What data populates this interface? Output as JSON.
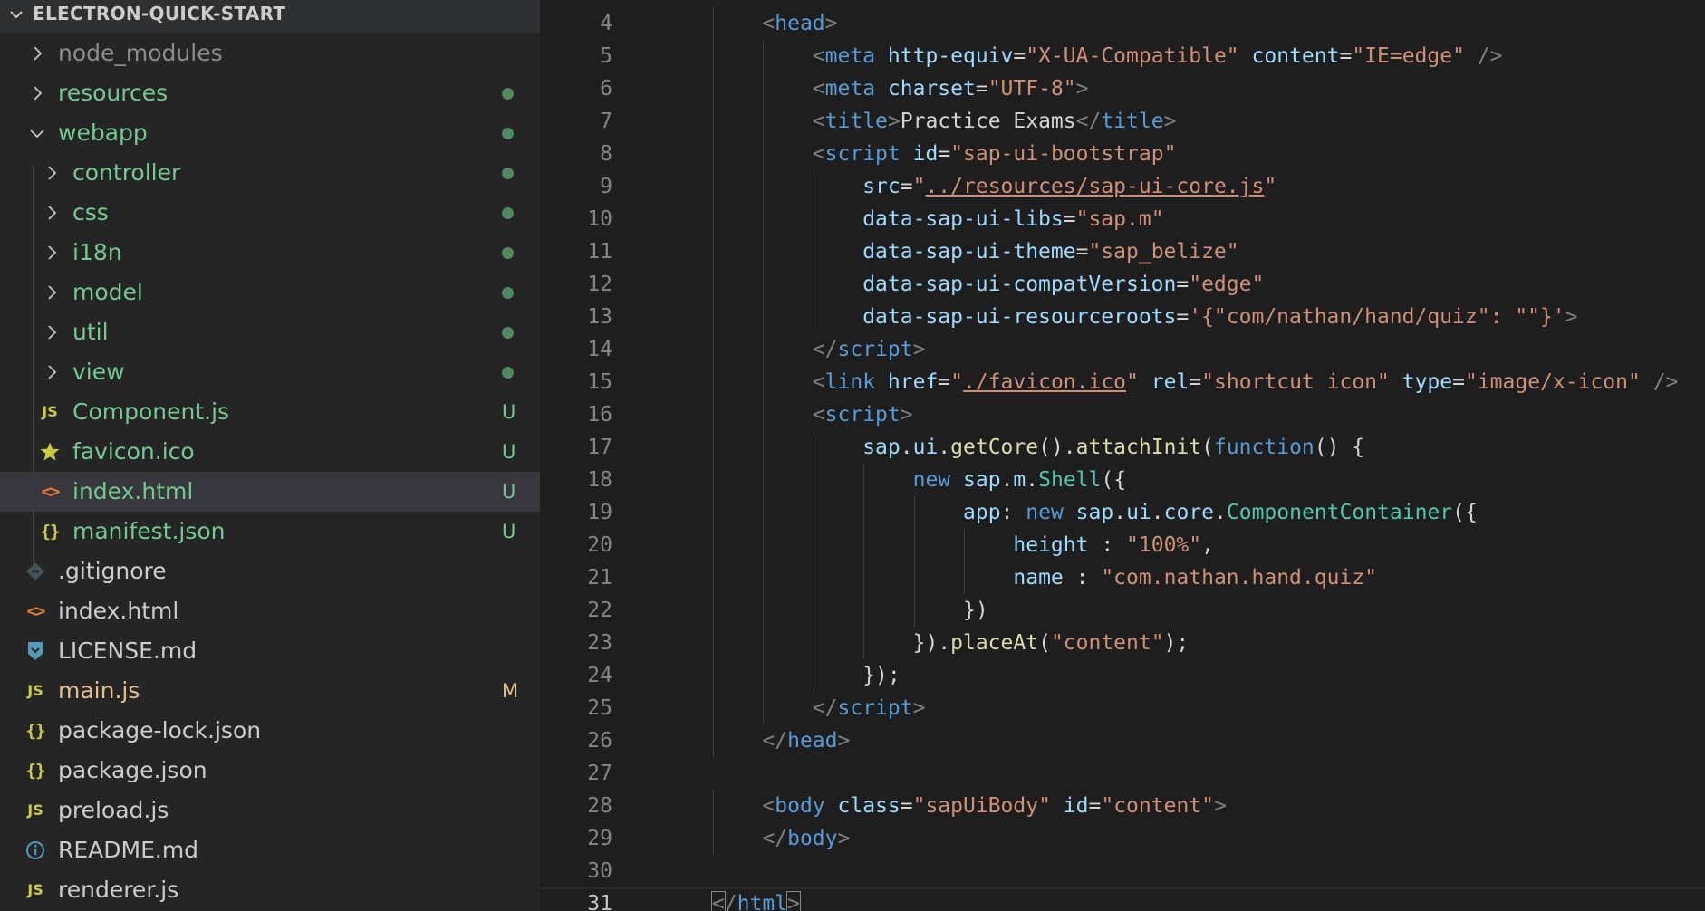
{
  "explorer": {
    "title": "ELECTRON-QUICK-START",
    "items": [
      {
        "label": "node_modules",
        "kind": "folder",
        "expanded": false,
        "level": 0,
        "color": "#8c8c8c",
        "decoration": ""
      },
      {
        "label": "resources",
        "kind": "folder",
        "expanded": false,
        "level": 0,
        "color": "#73c991",
        "decoration": "dot"
      },
      {
        "label": "webapp",
        "kind": "folder",
        "expanded": true,
        "level": 0,
        "color": "#73c991",
        "decoration": "dot"
      },
      {
        "label": "controller",
        "kind": "folder",
        "expanded": false,
        "level": 1,
        "color": "#73c991",
        "decoration": "dot"
      },
      {
        "label": "css",
        "kind": "folder",
        "expanded": false,
        "level": 1,
        "color": "#73c991",
        "decoration": "dot"
      },
      {
        "label": "i18n",
        "kind": "folder",
        "expanded": false,
        "level": 1,
        "color": "#73c991",
        "decoration": "dot"
      },
      {
        "label": "model",
        "kind": "folder",
        "expanded": false,
        "level": 1,
        "color": "#73c991",
        "decoration": "dot"
      },
      {
        "label": "util",
        "kind": "folder",
        "expanded": false,
        "level": 1,
        "color": "#73c991",
        "decoration": "dot"
      },
      {
        "label": "view",
        "kind": "folder",
        "expanded": false,
        "level": 1,
        "color": "#73c991",
        "decoration": "dot"
      },
      {
        "label": "Component.js",
        "kind": "js",
        "level": 1,
        "color": "#73c991",
        "decoration": "U"
      },
      {
        "label": "favicon.ico",
        "kind": "star",
        "level": 1,
        "color": "#73c991",
        "decoration": "U"
      },
      {
        "label": "index.html",
        "kind": "html",
        "level": 1,
        "color": "#73c991",
        "decoration": "U",
        "selected": true
      },
      {
        "label": "manifest.json",
        "kind": "json",
        "level": 1,
        "color": "#73c991",
        "decoration": "U"
      },
      {
        "label": ".gitignore",
        "kind": "git",
        "level": 0,
        "color": "#cccccc",
        "decoration": ""
      },
      {
        "label": "index.html",
        "kind": "html",
        "level": 0,
        "color": "#cccccc",
        "decoration": ""
      },
      {
        "label": "LICENSE.md",
        "kind": "license",
        "level": 0,
        "color": "#cccccc",
        "decoration": ""
      },
      {
        "label": "main.js",
        "kind": "js",
        "level": 0,
        "color": "#e2c08d",
        "decoration": "M"
      },
      {
        "label": "package-lock.json",
        "kind": "json",
        "level": 0,
        "color": "#cccccc",
        "decoration": ""
      },
      {
        "label": "package.json",
        "kind": "json",
        "level": 0,
        "color": "#cccccc",
        "decoration": ""
      },
      {
        "label": "preload.js",
        "kind": "js",
        "level": 0,
        "color": "#cccccc",
        "decoration": ""
      },
      {
        "label": "README.md",
        "kind": "info",
        "level": 0,
        "color": "#cccccc",
        "decoration": ""
      },
      {
        "label": "renderer.js",
        "kind": "js",
        "level": 0,
        "color": "#cccccc",
        "decoration": ""
      }
    ],
    "decoration_colors": {
      "dot": "#4f8a5f",
      "U": "#73c991",
      "M": "#e2c08d"
    }
  },
  "editor": {
    "active_line": 31,
    "lines": [
      {
        "n": 4,
        "indent": 1,
        "tokens": [
          [
            "tag",
            "<"
          ],
          [
            "tn",
            "head"
          ],
          [
            "tag",
            ">"
          ]
        ]
      },
      {
        "n": 5,
        "indent": 2,
        "tokens": [
          [
            "tag",
            "<"
          ],
          [
            "tn",
            "meta"
          ],
          [
            "txt",
            " "
          ],
          [
            "attr",
            "http-equiv"
          ],
          [
            "txt",
            "="
          ],
          [
            "str",
            "\"X-UA-Compatible\""
          ],
          [
            "txt",
            " "
          ],
          [
            "attr",
            "content"
          ],
          [
            "txt",
            "="
          ],
          [
            "str",
            "\"IE=edge\""
          ],
          [
            "txt",
            " "
          ],
          [
            "tag",
            "/>"
          ]
        ]
      },
      {
        "n": 6,
        "indent": 2,
        "tokens": [
          [
            "tag",
            "<"
          ],
          [
            "tn",
            "meta"
          ],
          [
            "txt",
            " "
          ],
          [
            "attr",
            "charset"
          ],
          [
            "txt",
            "="
          ],
          [
            "str",
            "\"UTF-8\""
          ],
          [
            "tag",
            ">"
          ]
        ]
      },
      {
        "n": 7,
        "indent": 2,
        "tokens": [
          [
            "tag",
            "<"
          ],
          [
            "tn",
            "title"
          ],
          [
            "tag",
            ">"
          ],
          [
            "txt",
            "Practice Exams"
          ],
          [
            "tag",
            "</"
          ],
          [
            "tn",
            "title"
          ],
          [
            "tag",
            ">"
          ]
        ]
      },
      {
        "n": 8,
        "indent": 2,
        "tokens": [
          [
            "tag",
            "<"
          ],
          [
            "tn",
            "script"
          ],
          [
            "txt",
            " "
          ],
          [
            "attr",
            "id"
          ],
          [
            "txt",
            "="
          ],
          [
            "str",
            "\"sap-ui-bootstrap\""
          ]
        ]
      },
      {
        "n": 9,
        "indent": 3,
        "tokens": [
          [
            "attr",
            "src"
          ],
          [
            "txt",
            "="
          ],
          [
            "str",
            "\""
          ],
          [
            "link",
            "../resources/sap-ui-core.js"
          ],
          [
            "str",
            "\""
          ]
        ]
      },
      {
        "n": 10,
        "indent": 3,
        "tokens": [
          [
            "attr",
            "data-sap-ui-libs"
          ],
          [
            "txt",
            "="
          ],
          [
            "str",
            "\"sap.m\""
          ]
        ]
      },
      {
        "n": 11,
        "indent": 3,
        "tokens": [
          [
            "attr",
            "data-sap-ui-theme"
          ],
          [
            "txt",
            "="
          ],
          [
            "str",
            "\"sap_belize\""
          ]
        ]
      },
      {
        "n": 12,
        "indent": 3,
        "tokens": [
          [
            "attr",
            "data-sap-ui-compatVersion"
          ],
          [
            "txt",
            "="
          ],
          [
            "str",
            "\"edge\""
          ]
        ]
      },
      {
        "n": 13,
        "indent": 3,
        "tokens": [
          [
            "attr",
            "data-sap-ui-resourceroots"
          ],
          [
            "txt",
            "="
          ],
          [
            "str",
            "'{\"com/nathan/hand/quiz\": \"\"}'"
          ],
          [
            "tag",
            ">"
          ]
        ]
      },
      {
        "n": 14,
        "indent": 2,
        "tokens": [
          [
            "tag",
            "</"
          ],
          [
            "tn",
            "script"
          ],
          [
            "tag",
            ">"
          ]
        ]
      },
      {
        "n": 15,
        "indent": 2,
        "tokens": [
          [
            "tag",
            "<"
          ],
          [
            "tn",
            "link"
          ],
          [
            "txt",
            " "
          ],
          [
            "attr",
            "href"
          ],
          [
            "txt",
            "="
          ],
          [
            "str",
            "\""
          ],
          [
            "link",
            "./favicon.ico"
          ],
          [
            "str",
            "\""
          ],
          [
            "txt",
            " "
          ],
          [
            "attr",
            "rel"
          ],
          [
            "txt",
            "="
          ],
          [
            "str",
            "\"shortcut icon\""
          ],
          [
            "txt",
            " "
          ],
          [
            "attr",
            "type"
          ],
          [
            "txt",
            "="
          ],
          [
            "str",
            "\"image/x-icon\""
          ],
          [
            "txt",
            " "
          ],
          [
            "tag",
            "/>"
          ]
        ]
      },
      {
        "n": 16,
        "indent": 2,
        "tokens": [
          [
            "tag",
            "<"
          ],
          [
            "tn",
            "script"
          ],
          [
            "tag",
            ">"
          ]
        ]
      },
      {
        "n": 17,
        "indent": 3,
        "tokens": [
          [
            "var",
            "sap"
          ],
          [
            "txt",
            "."
          ],
          [
            "var",
            "ui"
          ],
          [
            "txt",
            "."
          ],
          [
            "fn",
            "getCore"
          ],
          [
            "txt",
            "()."
          ],
          [
            "fn",
            "attachInit"
          ],
          [
            "txt",
            "("
          ],
          [
            "kw",
            "function"
          ],
          [
            "txt",
            "() {"
          ]
        ]
      },
      {
        "n": 18,
        "indent": 4,
        "tokens": [
          [
            "kw",
            "new"
          ],
          [
            "txt",
            " "
          ],
          [
            "var",
            "sap"
          ],
          [
            "txt",
            "."
          ],
          [
            "var",
            "m"
          ],
          [
            "txt",
            "."
          ],
          [
            "cls",
            "Shell"
          ],
          [
            "txt",
            "({"
          ]
        ]
      },
      {
        "n": 19,
        "indent": 5,
        "tokens": [
          [
            "var",
            "app"
          ],
          [
            "txt",
            ": "
          ],
          [
            "kw",
            "new"
          ],
          [
            "txt",
            " "
          ],
          [
            "var",
            "sap"
          ],
          [
            "txt",
            "."
          ],
          [
            "var",
            "ui"
          ],
          [
            "txt",
            "."
          ],
          [
            "var",
            "core"
          ],
          [
            "txt",
            "."
          ],
          [
            "cls",
            "ComponentContainer"
          ],
          [
            "txt",
            "({"
          ]
        ]
      },
      {
        "n": 20,
        "indent": 6,
        "tokens": [
          [
            "var",
            "height"
          ],
          [
            "txt",
            " : "
          ],
          [
            "str",
            "\"100%\""
          ],
          [
            "txt",
            ","
          ]
        ]
      },
      {
        "n": 21,
        "indent": 6,
        "tokens": [
          [
            "var",
            "name"
          ],
          [
            "txt",
            " : "
          ],
          [
            "str",
            "\"com.nathan.hand.quiz\""
          ]
        ]
      },
      {
        "n": 22,
        "indent": 5,
        "tokens": [
          [
            "txt",
            "})"
          ]
        ]
      },
      {
        "n": 23,
        "indent": 4,
        "tokens": [
          [
            "txt",
            "})."
          ],
          [
            "fn",
            "placeAt"
          ],
          [
            "txt",
            "("
          ],
          [
            "str",
            "\"content\""
          ],
          [
            "txt",
            ");"
          ]
        ]
      },
      {
        "n": 24,
        "indent": 3,
        "tokens": [
          [
            "txt",
            "});"
          ]
        ]
      },
      {
        "n": 25,
        "indent": 2,
        "tokens": [
          [
            "tag",
            "</"
          ],
          [
            "tn",
            "script"
          ],
          [
            "tag",
            ">"
          ]
        ]
      },
      {
        "n": 26,
        "indent": 1,
        "tokens": [
          [
            "tag",
            "</"
          ],
          [
            "tn",
            "head"
          ],
          [
            "tag",
            ">"
          ]
        ]
      },
      {
        "n": 27,
        "indent": 0,
        "tokens": []
      },
      {
        "n": 28,
        "indent": 1,
        "tokens": [
          [
            "tag",
            "<"
          ],
          [
            "tn",
            "body"
          ],
          [
            "txt",
            " "
          ],
          [
            "attr",
            "class"
          ],
          [
            "txt",
            "="
          ],
          [
            "str",
            "\"sapUiBody\""
          ],
          [
            "txt",
            " "
          ],
          [
            "attr",
            "id"
          ],
          [
            "txt",
            "="
          ],
          [
            "str",
            "\"content\""
          ],
          [
            "tag",
            ">"
          ]
        ]
      },
      {
        "n": 29,
        "indent": 1,
        "tokens": [
          [
            "tag",
            "</"
          ],
          [
            "tn",
            "body"
          ],
          [
            "tag",
            ">"
          ]
        ]
      },
      {
        "n": 30,
        "indent": 0,
        "tokens": []
      },
      {
        "n": 31,
        "indent": 0,
        "tokens": [
          [
            "bracket",
            "<"
          ],
          [
            "tag",
            "/"
          ],
          [
            "tn",
            "html"
          ],
          [
            "bracket",
            ">"
          ]
        ]
      }
    ]
  }
}
